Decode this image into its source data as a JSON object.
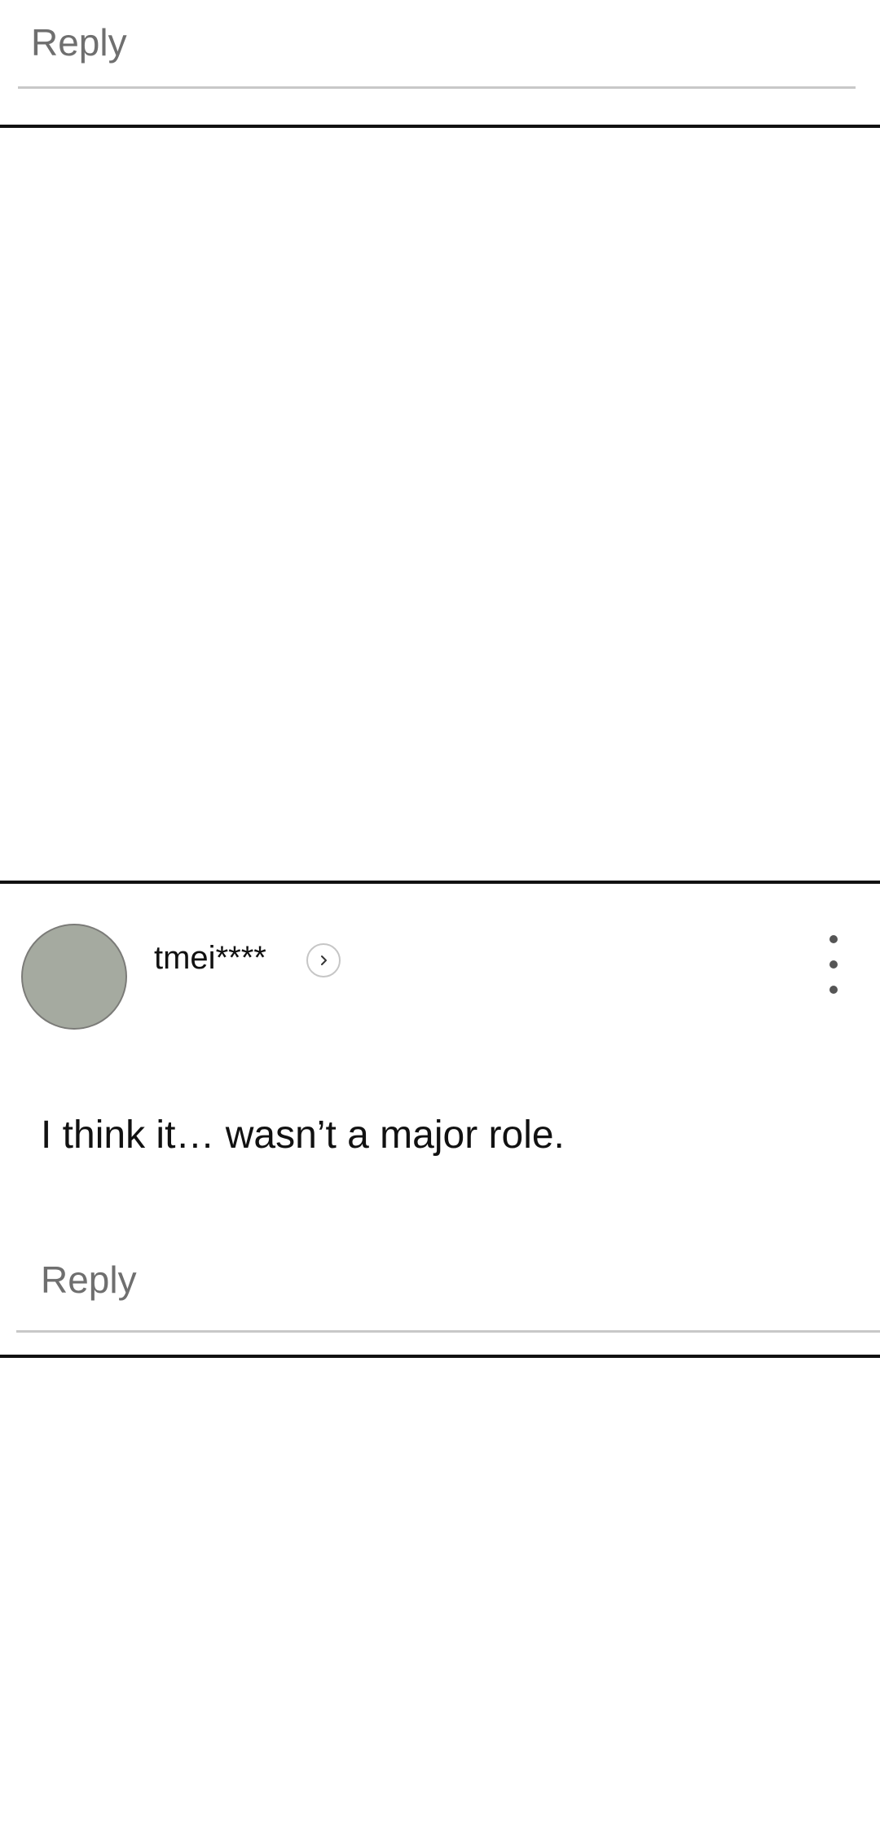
{
  "previous_comment": {
    "reply_label": "Reply"
  },
  "comment": {
    "username": "tmei****",
    "body": "I think it… wasn’t a major role.",
    "reply_label": "Reply",
    "avatar_color": "#a5aaa0"
  },
  "icons": {
    "profile": "chevron-right-icon",
    "menu": "more-vertical-icon"
  }
}
